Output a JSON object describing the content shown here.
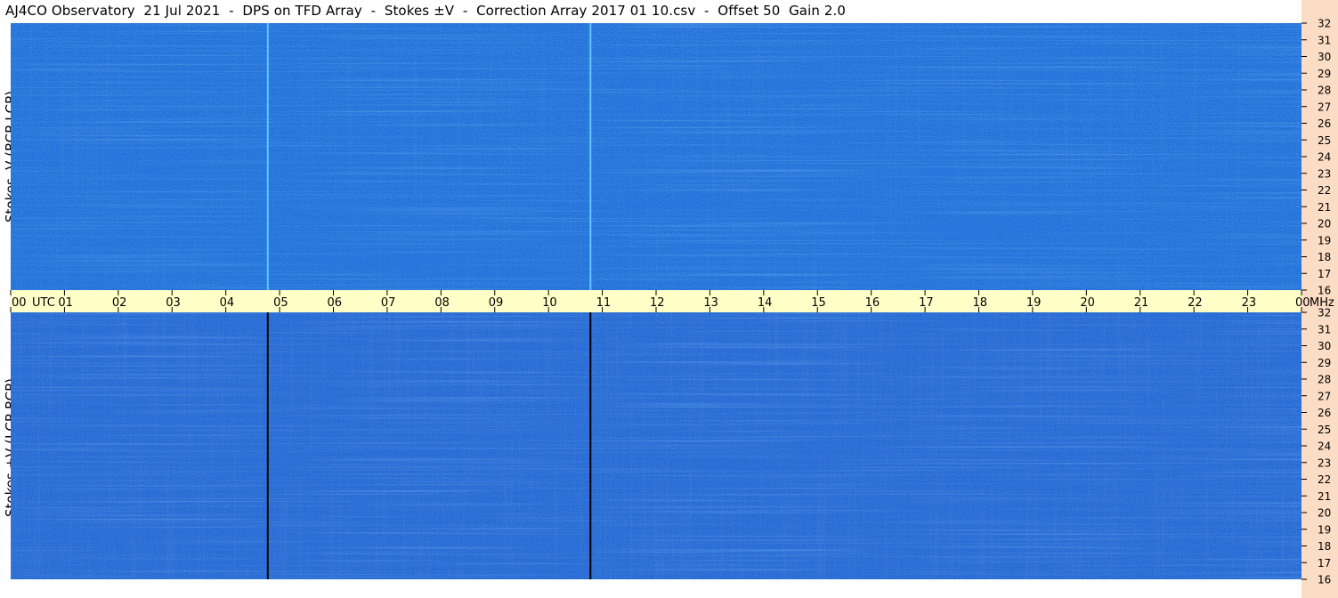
{
  "chart_data": [
    {
      "type": "heatmap",
      "title": "AJ4CO Observatory  21 Jul 2021  -  DPS on TFD Array  -  Stokes ±V  -  Correction Array 2017 01 10.csv  -  Offset 50  Gain 2.0",
      "ylabel": "Stokes -V (RCP-LCP)",
      "y_ticks": [
        "32",
        "31",
        "30",
        "29",
        "28",
        "27",
        "26",
        "25",
        "24",
        "23",
        "22",
        "21",
        "20",
        "19",
        "18",
        "17",
        "16"
      ],
      "ylim": [
        16,
        32
      ],
      "x_ticks": [
        "00",
        "01",
        "02",
        "03",
        "04",
        "05",
        "06",
        "07",
        "08",
        "09",
        "10",
        "11",
        "12",
        "13",
        "14",
        "15",
        "16",
        "17",
        "18",
        "19",
        "20",
        "21",
        "22",
        "23",
        "00"
      ],
      "xlim": [
        0,
        24
      ],
      "x_unit_label": "UTC",
      "y_unit_label": "MHz",
      "base_color": "#1f6fd8",
      "divider_lines_utc": [
        4.78,
        10.78
      ],
      "divider_color": "#5fc6ff"
    },
    {
      "type": "heatmap",
      "ylabel": "Stokes +V (LCP-RCP)",
      "y_ticks": [
        "32",
        "31",
        "30",
        "29",
        "28",
        "27",
        "26",
        "25",
        "24",
        "23",
        "22",
        "21",
        "20",
        "19",
        "18",
        "17",
        "16"
      ],
      "ylim": [
        16,
        32
      ],
      "xlim": [
        0,
        24
      ],
      "base_color": "#2467d2",
      "divider_lines_utc": [
        4.78,
        10.78
      ],
      "divider_color": "#000000"
    }
  ],
  "colors": {
    "time_band": "#ffffc8",
    "right_strip": "#fbdcc4",
    "noise_bright": "#5fc6ff",
    "noise_yellow": "#ffe85a",
    "noise_dark": "#0a1a5a"
  }
}
